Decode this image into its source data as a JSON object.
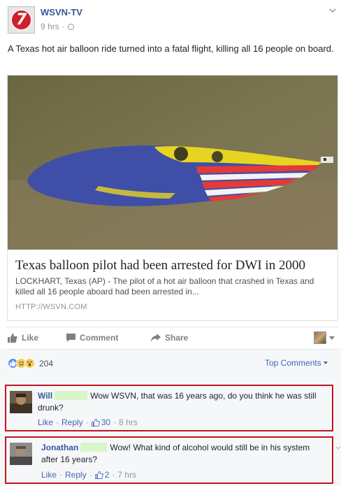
{
  "post": {
    "page_name": "WSVN-TV",
    "page_logo_glyph": "7",
    "time": "9 hrs",
    "text": "A Texas hot air balloon ride turned into a fatal flight, killing all 16 people on board.",
    "link": {
      "title": "Texas balloon pilot had been arrested for DWI in 2000",
      "description": "LOCKHART, Texas (AP) - The pilot of a hot air balloon that crashed in Texas and killed all 16 people aboard had been arrested in...",
      "url": "HTTP://WSVN.COM"
    }
  },
  "actions": {
    "like": "Like",
    "comment": "Comment",
    "share": "Share"
  },
  "reactions": {
    "count": "204",
    "icons": [
      "like-icon",
      "sad-icon",
      "wow-icon"
    ]
  },
  "top_comments": "Top Comments",
  "comments": [
    {
      "author": "Will",
      "text": "Wow WSVN, that was 16 years ago, do you think he was still drunk?",
      "like_label": "Like",
      "reply_label": "Reply",
      "likes": "30",
      "time": "8 hrs"
    },
    {
      "author": "Jonathan",
      "text": "Wow! What kind of alcohol would still be in his system after 16 years?",
      "like_label": "Like",
      "reply_label": "Reply",
      "likes": "2",
      "time": "7 hrs"
    }
  ],
  "colors": {
    "link_blue": "#365899",
    "highlight_border": "#c2161f",
    "redaction": "#d8f5c8"
  }
}
